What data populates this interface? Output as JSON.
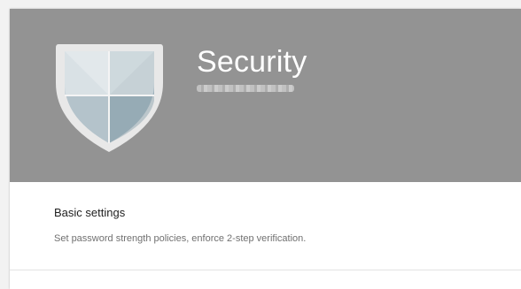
{
  "header": {
    "title": "Security",
    "subtitle_redacted": true,
    "background_color": "#939393",
    "icon": "shield-icon"
  },
  "sections": [
    {
      "title": "Basic settings",
      "description": "Set password strength policies, enforce 2-step verification."
    }
  ]
}
